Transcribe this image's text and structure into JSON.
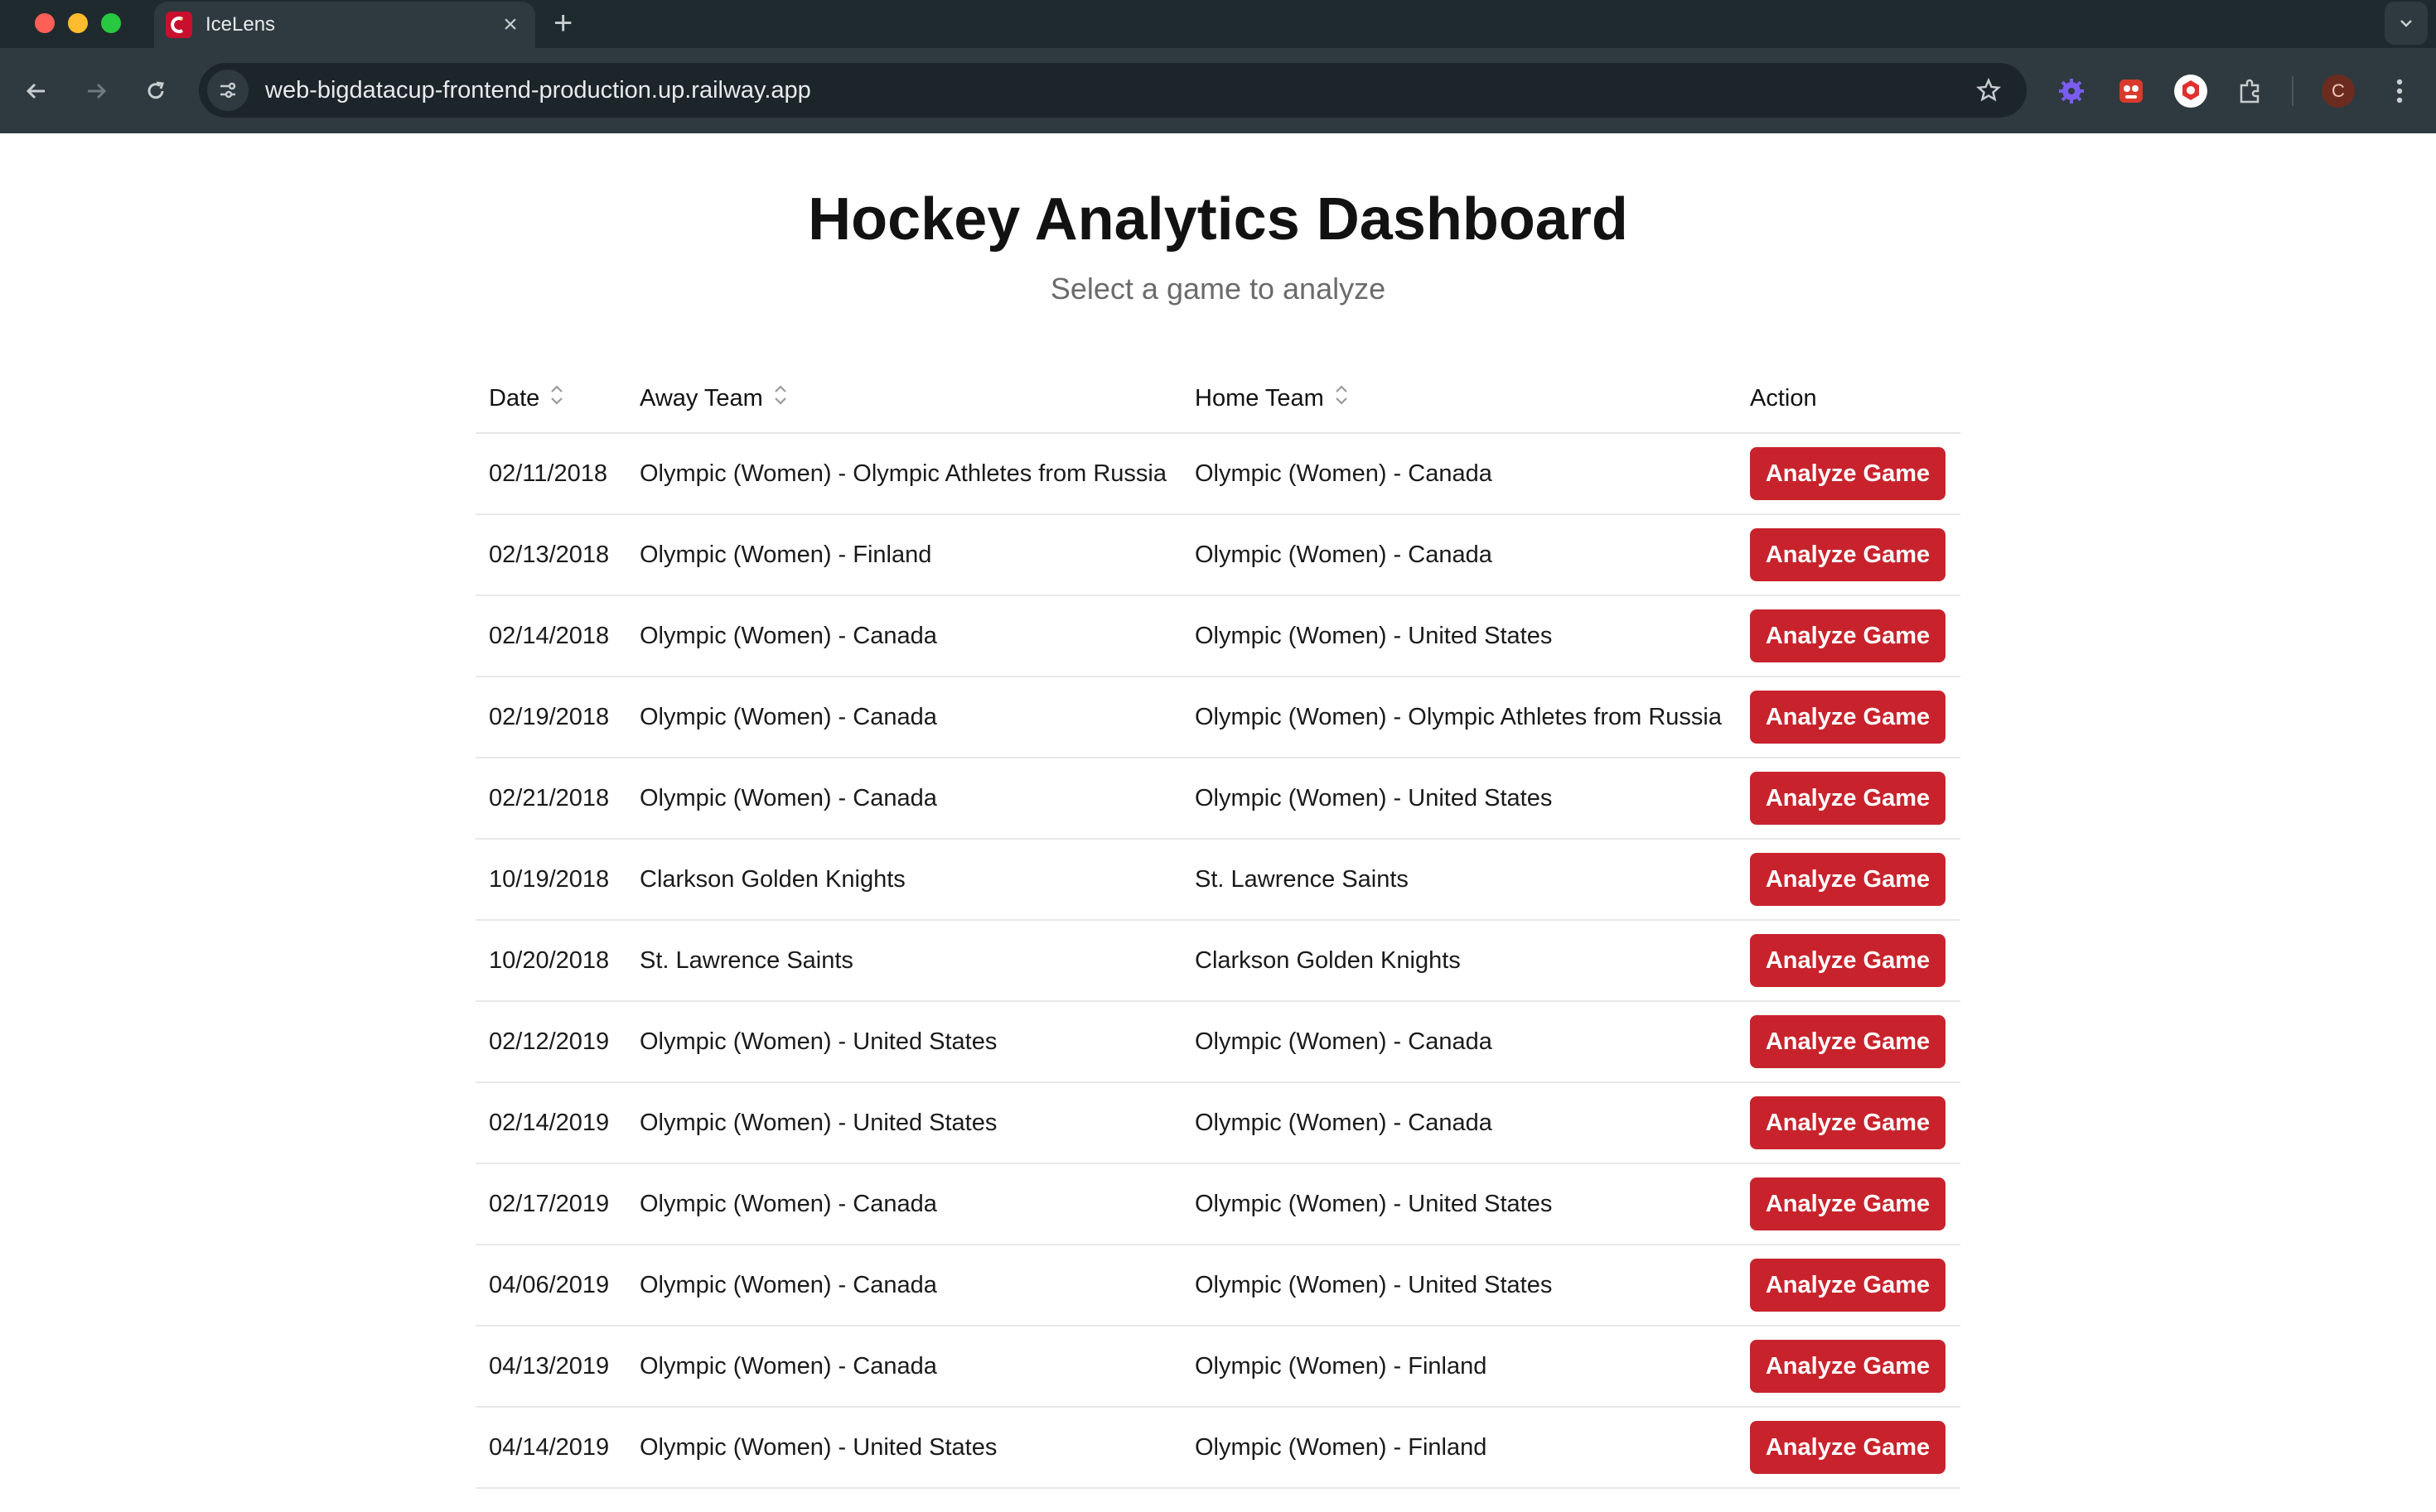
{
  "browser": {
    "tab_title": "IceLens",
    "tab_close": "×",
    "new_tab": "+",
    "url": "web-bigdatacup-frontend-production.up.railway.app",
    "profile_initial": "C",
    "icons": [
      "back-icon",
      "forward-icon",
      "reload-icon",
      "site-settings-icon",
      "bookmark-star-icon",
      "extension-gear-icon",
      "extension-game-icon",
      "extension-shield-icon",
      "extensions-puzzle-icon",
      "menu-kebab-icon",
      "tab-search-icon"
    ]
  },
  "header": {
    "title": "Hockey Analytics Dashboard",
    "subtitle": "Select a game to analyze"
  },
  "table": {
    "columns": [
      "Date",
      "Away Team",
      "Home Team",
      "Action"
    ],
    "rows": [
      {
        "date": "02/11/2018",
        "away": "Olympic (Women) - Olympic Athletes from Russia",
        "home": "Olympic (Women) - Canada",
        "action": "Analyze Game"
      },
      {
        "date": "02/13/2018",
        "away": "Olympic (Women) - Finland",
        "home": "Olympic (Women) - Canada",
        "action": "Analyze Game"
      },
      {
        "date": "02/14/2018",
        "away": "Olympic (Women) - Canada",
        "home": "Olympic (Women) - United States",
        "action": "Analyze Game"
      },
      {
        "date": "02/19/2018",
        "away": "Olympic (Women) - Canada",
        "home": "Olympic (Women) - Olympic Athletes from Russia",
        "action": "Analyze Game"
      },
      {
        "date": "02/21/2018",
        "away": "Olympic (Women) - Canada",
        "home": "Olympic (Women) - United States",
        "action": "Analyze Game"
      },
      {
        "date": "10/19/2018",
        "away": "Clarkson Golden Knights",
        "home": "St. Lawrence Saints",
        "action": "Analyze Game"
      },
      {
        "date": "10/20/2018",
        "away": "St. Lawrence Saints",
        "home": "Clarkson Golden Knights",
        "action": "Analyze Game"
      },
      {
        "date": "02/12/2019",
        "away": "Olympic (Women) - United States",
        "home": "Olympic (Women) - Canada",
        "action": "Analyze Game"
      },
      {
        "date": "02/14/2019",
        "away": "Olympic (Women) - United States",
        "home": "Olympic (Women) - Canada",
        "action": "Analyze Game"
      },
      {
        "date": "02/17/2019",
        "away": "Olympic (Women) - Canada",
        "home": "Olympic (Women) - United States",
        "action": "Analyze Game"
      },
      {
        "date": "04/06/2019",
        "away": "Olympic (Women) - Canada",
        "home": "Olympic (Women) - United States",
        "action": "Analyze Game"
      },
      {
        "date": "04/13/2019",
        "away": "Olympic (Women) - Canada",
        "home": "Olympic (Women) - Finland",
        "action": "Analyze Game"
      },
      {
        "date": "04/14/2019",
        "away": "Olympic (Women) - United States",
        "home": "Olympic (Women) - Finland",
        "action": "Analyze Game"
      }
    ]
  },
  "colors": {
    "accent": "#c8232c",
    "chrome_dark": "#1f2a2e",
    "chrome_toolbar": "#2e3a3f"
  }
}
